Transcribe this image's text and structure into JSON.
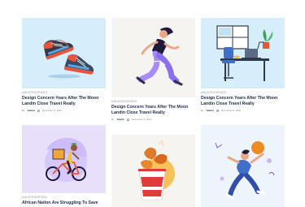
{
  "posts": [
    {
      "category": "Uncategorized",
      "title_line1": "Design Concern Years After The Moon",
      "title_line2": "Landin Close Travel Really",
      "by": "By",
      "author": "Admin",
      "date": "December 3, 2021",
      "thumb_color": "#d6eefb",
      "icon": "running-shoes-illustration"
    },
    {
      "category": "Uncategorized",
      "title_line1": "Design Concern Years After The Moon",
      "title_line2": "Landin Close Travel Really",
      "by": "By",
      "author": "Admin",
      "date": "December 3, 2021",
      "thumb_color": "#f6f4f1",
      "icon": "runner-illustration"
    },
    {
      "category": "Uncategorized",
      "title_line1": "Design Concern Years After The Moon",
      "title_line2": "Landin Close Travel Really",
      "by": "By",
      "author": "Admin",
      "date": "December 3, 2021",
      "thumb_color": "#d6eefb",
      "icon": "desk-workspace-illustration"
    },
    {
      "category": "Uncategorized",
      "title_line1": "African Nation Are Struggling To Save",
      "thumb_color": "#e8e0fb",
      "icon": "delivery-cyclist-illustration"
    },
    {
      "category": "",
      "thumb_color": "#f6f4f1",
      "icon": "fried-chicken-bucket-illustration"
    },
    {
      "category": "",
      "thumb_color": "#eef4fb",
      "icon": "jumping-person-illustration"
    }
  ],
  "colors": {
    "title": "#1f2d4a",
    "meta": "#8a8a8a",
    "accent_orange": "#f08a24",
    "accent_purple": "#7b5ce6"
  }
}
